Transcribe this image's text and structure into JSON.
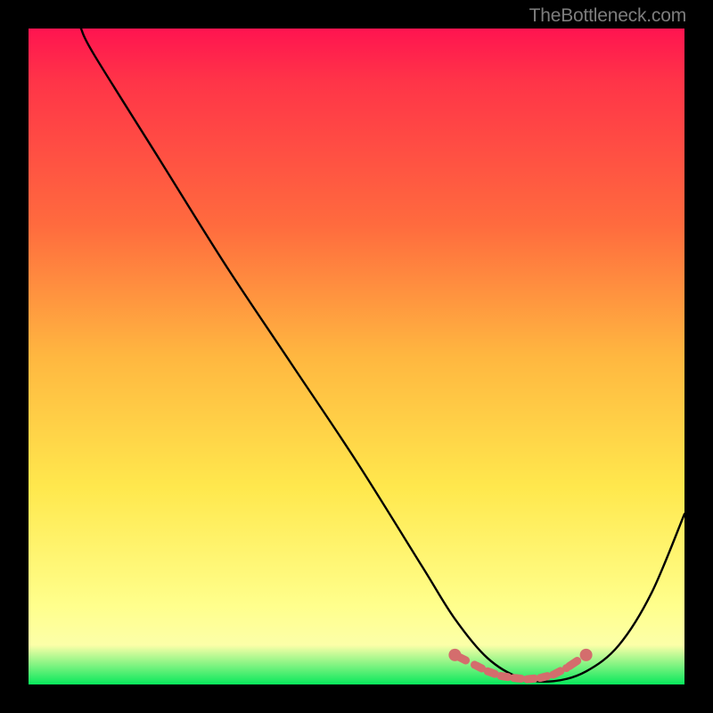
{
  "attribution": "TheBottleneck.com",
  "chart_data": {
    "type": "line",
    "title": "",
    "xlabel": "",
    "ylabel": "",
    "xlim": [
      0,
      100
    ],
    "ylim": [
      0,
      100
    ],
    "series": [
      {
        "name": "bottleneck-curve",
        "x": [
          8,
          10,
          20,
          30,
          40,
          50,
          60,
          65,
          70,
          75,
          80,
          85,
          90,
          95,
          100
        ],
        "y": [
          100,
          96,
          80,
          64,
          49,
          34,
          18,
          10,
          4,
          1,
          0.5,
          2,
          6,
          14,
          26
        ]
      }
    ],
    "markers": {
      "name": "recommended-range",
      "color": "#d46d6d",
      "x": [
        65,
        68,
        70,
        72,
        74,
        76,
        78,
        80,
        82,
        85
      ],
      "y": [
        4.5,
        3,
        2,
        1.3,
        1,
        0.8,
        1,
        1.5,
        2.5,
        4.5
      ]
    }
  },
  "colors": {
    "curve": "#000000",
    "marker": "#d46d6d",
    "background_top": "#ff1450",
    "background_bottom": "#08e85c",
    "frame": "#000000"
  }
}
